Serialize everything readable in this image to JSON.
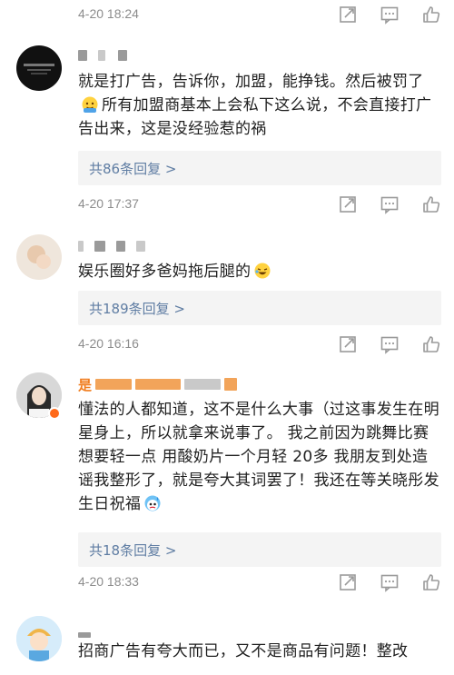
{
  "comments": [
    {
      "time": "4-20 18:24"
    },
    {
      "text_a": "就是打广告，告诉你，加盟，能挣钱。然后被罚了",
      "text_b": "所有加盟商基本上会私下这么说，不会直接打广告出来，这是没经验惹的祸",
      "replies": "共86条回复 >",
      "time": "4-20 17:37"
    },
    {
      "text_a": "娱乐圈好多爸妈拖后腿的",
      "replies": "共189条回复 >",
      "time": "4-20 16:16"
    },
    {
      "name_frag": "是",
      "text_a": "懂法的人都知道，这不是什么大事（过这事发生在明星身上，所以就拿来说事了。 我之前因为跳舞比赛想要轻一点 用酸奶片一个月轻 20多 我朋友到处造谣我整形了，就是夸大其词罢了！我还在等关晓彤发生日祝福",
      "replies": "共18条回复 >",
      "time": "4-20 18:33"
    },
    {
      "text_a": "招商广告有夸大而已，又不是商品有问题！整改"
    }
  ],
  "icons": [
    "share-icon",
    "comment-icon",
    "like-icon",
    "shy-emoji",
    "laugh-emoji",
    "sweat-emoji"
  ]
}
